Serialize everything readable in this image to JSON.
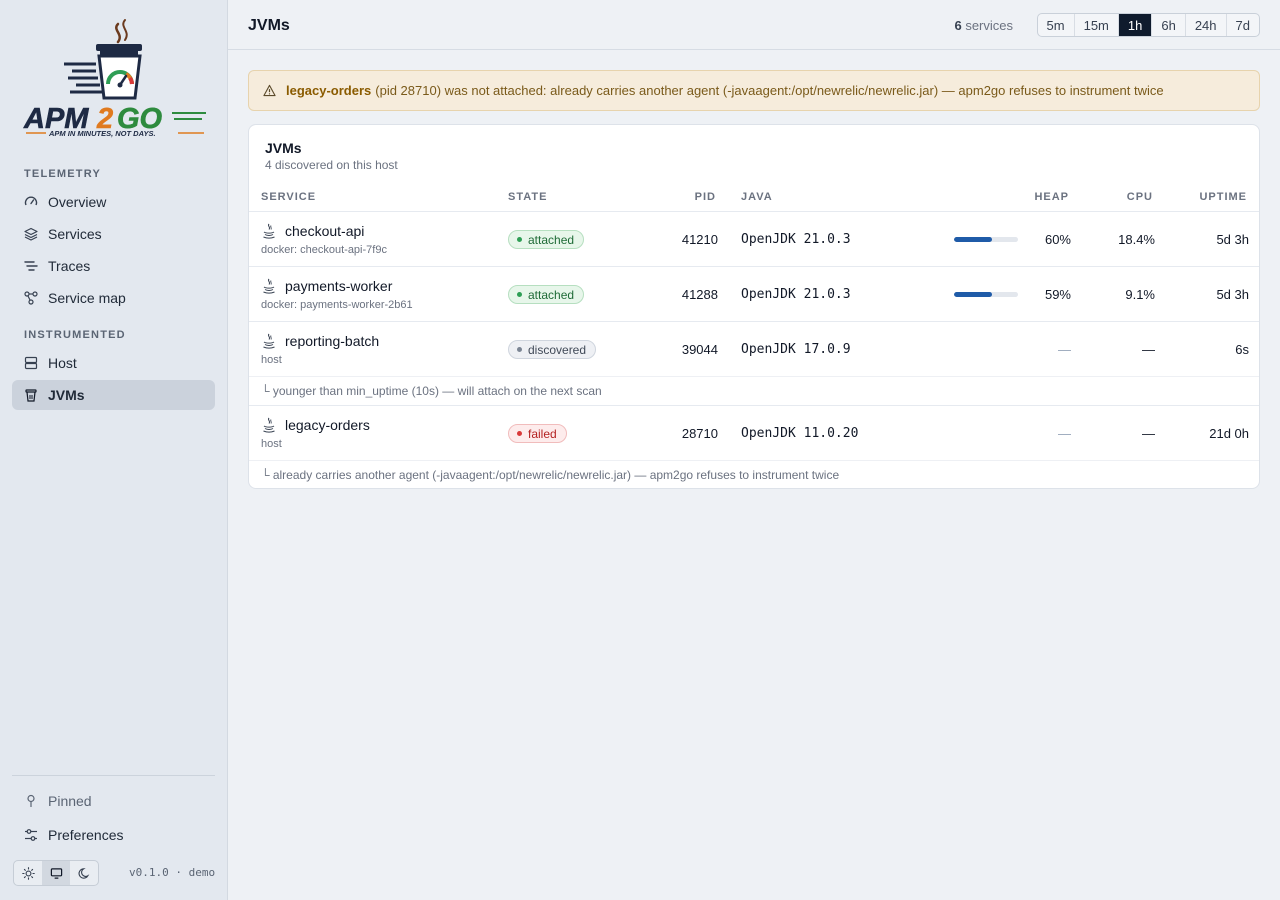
{
  "brand": {
    "name": "APM2GO",
    "tagline": "APM IN MINUTES, NOT DAYS."
  },
  "sidebar": {
    "sections": [
      {
        "label": "TELEMETRY",
        "items": [
          {
            "label": "Overview",
            "icon": "gauge-icon"
          },
          {
            "label": "Services",
            "icon": "layers-icon"
          },
          {
            "label": "Traces",
            "icon": "traces-icon"
          },
          {
            "label": "Service map",
            "icon": "graph-icon"
          }
        ]
      },
      {
        "label": "INSTRUMENTED",
        "items": [
          {
            "label": "Host",
            "icon": "server-icon"
          },
          {
            "label": "JVMs",
            "icon": "coffee-cup-icon",
            "active": true
          }
        ]
      }
    ],
    "footer": {
      "pinned": "Pinned",
      "preferences": "Preferences",
      "theme_options": [
        "light",
        "system",
        "dark"
      ],
      "theme_selected": "system",
      "version": "v0.1.0 · demo"
    }
  },
  "header": {
    "title": "JVMs",
    "service_count": "6",
    "service_count_label": "services",
    "time_ranges": [
      "5m",
      "15m",
      "1h",
      "6h",
      "24h",
      "7d"
    ],
    "selected_range": "1h"
  },
  "banner": {
    "service": "legacy-orders",
    "message": "(pid 28710) was not attached: already carries another agent (-javaagent:/opt/newrelic/newrelic.jar) — apm2go refuses to instrument twice"
  },
  "table": {
    "title": "JVMs",
    "subtitle": "4 discovered on this host",
    "columns": [
      "SERVICE",
      "STATE",
      "PID",
      "JAVA",
      "HEAP",
      "CPU",
      "UPTIME"
    ],
    "rows": [
      {
        "name": "checkout-api",
        "source": "docker: checkout-api-7f9c",
        "state": "attached",
        "pid": "41210",
        "java": "OpenJDK 21.0.3",
        "heap_fraction": 0.6,
        "heap": "60%",
        "cpu": "18.4%",
        "uptime": "5d 3h",
        "note": ""
      },
      {
        "name": "payments-worker",
        "source": "docker: payments-worker-2b61",
        "state": "attached",
        "pid": "41288",
        "java": "OpenJDK 21.0.3",
        "heap_fraction": 0.59,
        "heap": "59%",
        "cpu": "9.1%",
        "uptime": "5d 3h",
        "note": ""
      },
      {
        "name": "reporting-batch",
        "source": "host",
        "state": "discovered",
        "pid": "39044",
        "java": "OpenJDK 17.0.9",
        "heap_fraction": null,
        "heap": "—",
        "cpu": "—",
        "uptime": "6s",
        "note": "younger than min_uptime (10s) — will attach on the next scan"
      },
      {
        "name": "legacy-orders",
        "source": "host",
        "state": "failed",
        "pid": "28710",
        "java": "OpenJDK 11.0.20",
        "heap_fraction": null,
        "heap": "—",
        "cpu": "—",
        "uptime": "21d 0h",
        "note": "already carries another agent (-javaagent:/opt/newrelic/newrelic.jar) — apm2go refuses to instrument twice"
      }
    ]
  },
  "colors": {
    "accent": "#0f1b2d",
    "heap_bar": "#1f5ba8",
    "attached": "#2e9e55",
    "failed": "#d93a3a",
    "warning_bg": "#f6ecdc"
  }
}
